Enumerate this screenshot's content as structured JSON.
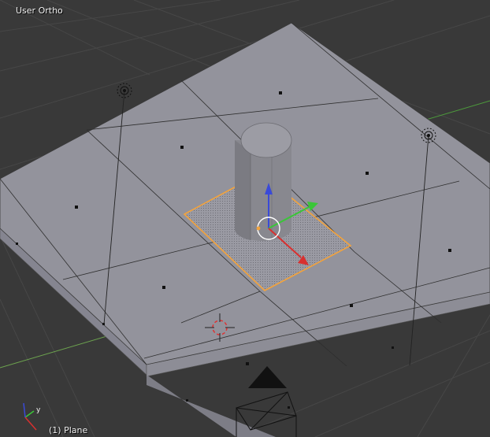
{
  "viewport": {
    "view_name": "User Ortho",
    "active_object": "(1) Plane"
  },
  "axis_gizmo": {
    "y_label": "y"
  },
  "icons": [
    "lamp-icon",
    "camera-icon",
    "3d-cursor-icon",
    "axis-gizmo-icon"
  ],
  "colors": {
    "background": "#393939",
    "grid": "#474747",
    "mesh_top": "#93939c",
    "mesh_side": "#8a8a92",
    "selection": "#f3a33c",
    "axis_x": "#d8302f",
    "axis_y": "#3ac638",
    "axis_z": "#3a4ad8"
  }
}
